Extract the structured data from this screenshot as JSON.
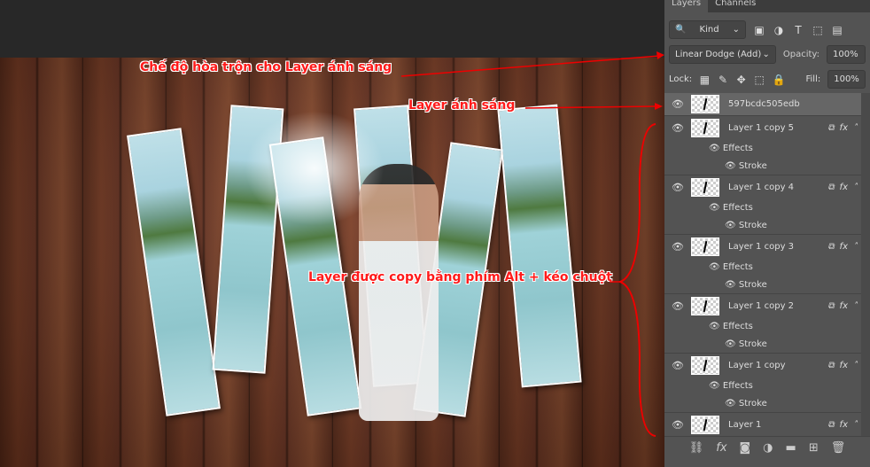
{
  "panel": {
    "tabs": [
      "Layers",
      "Channels"
    ],
    "filter_kind": "Kind",
    "blend_mode": "Linear Dodge (Add)",
    "opacity_label": "Opacity:",
    "opacity": "100%",
    "lock_label": "Lock:",
    "fill_label": "Fill:",
    "fill": "100%",
    "top_layer": "597bcdc505edb",
    "layers": [
      {
        "name": "Layer 1 copy 5",
        "effects": "Effects",
        "stroke": "Stroke"
      },
      {
        "name": "Layer 1 copy 4",
        "effects": "Effects",
        "stroke": "Stroke"
      },
      {
        "name": "Layer 1 copy 3",
        "effects": "Effects",
        "stroke": "Stroke"
      },
      {
        "name": "Layer 1 copy 2",
        "effects": "Effects",
        "stroke": "Stroke"
      },
      {
        "name": "Layer 1 copy",
        "effects": "Effects",
        "stroke": "Stroke"
      },
      {
        "name": "Layer 1"
      }
    ]
  },
  "annotations": {
    "blend": "Chế độ hòa trộn cho Layer ánh sáng",
    "light": "Layer ánh sáng",
    "copy": "Layer được copy bằng phím Alt + kéo chuột"
  },
  "colors": {
    "annotation": "#ff1a1a",
    "panel": "#535353"
  }
}
